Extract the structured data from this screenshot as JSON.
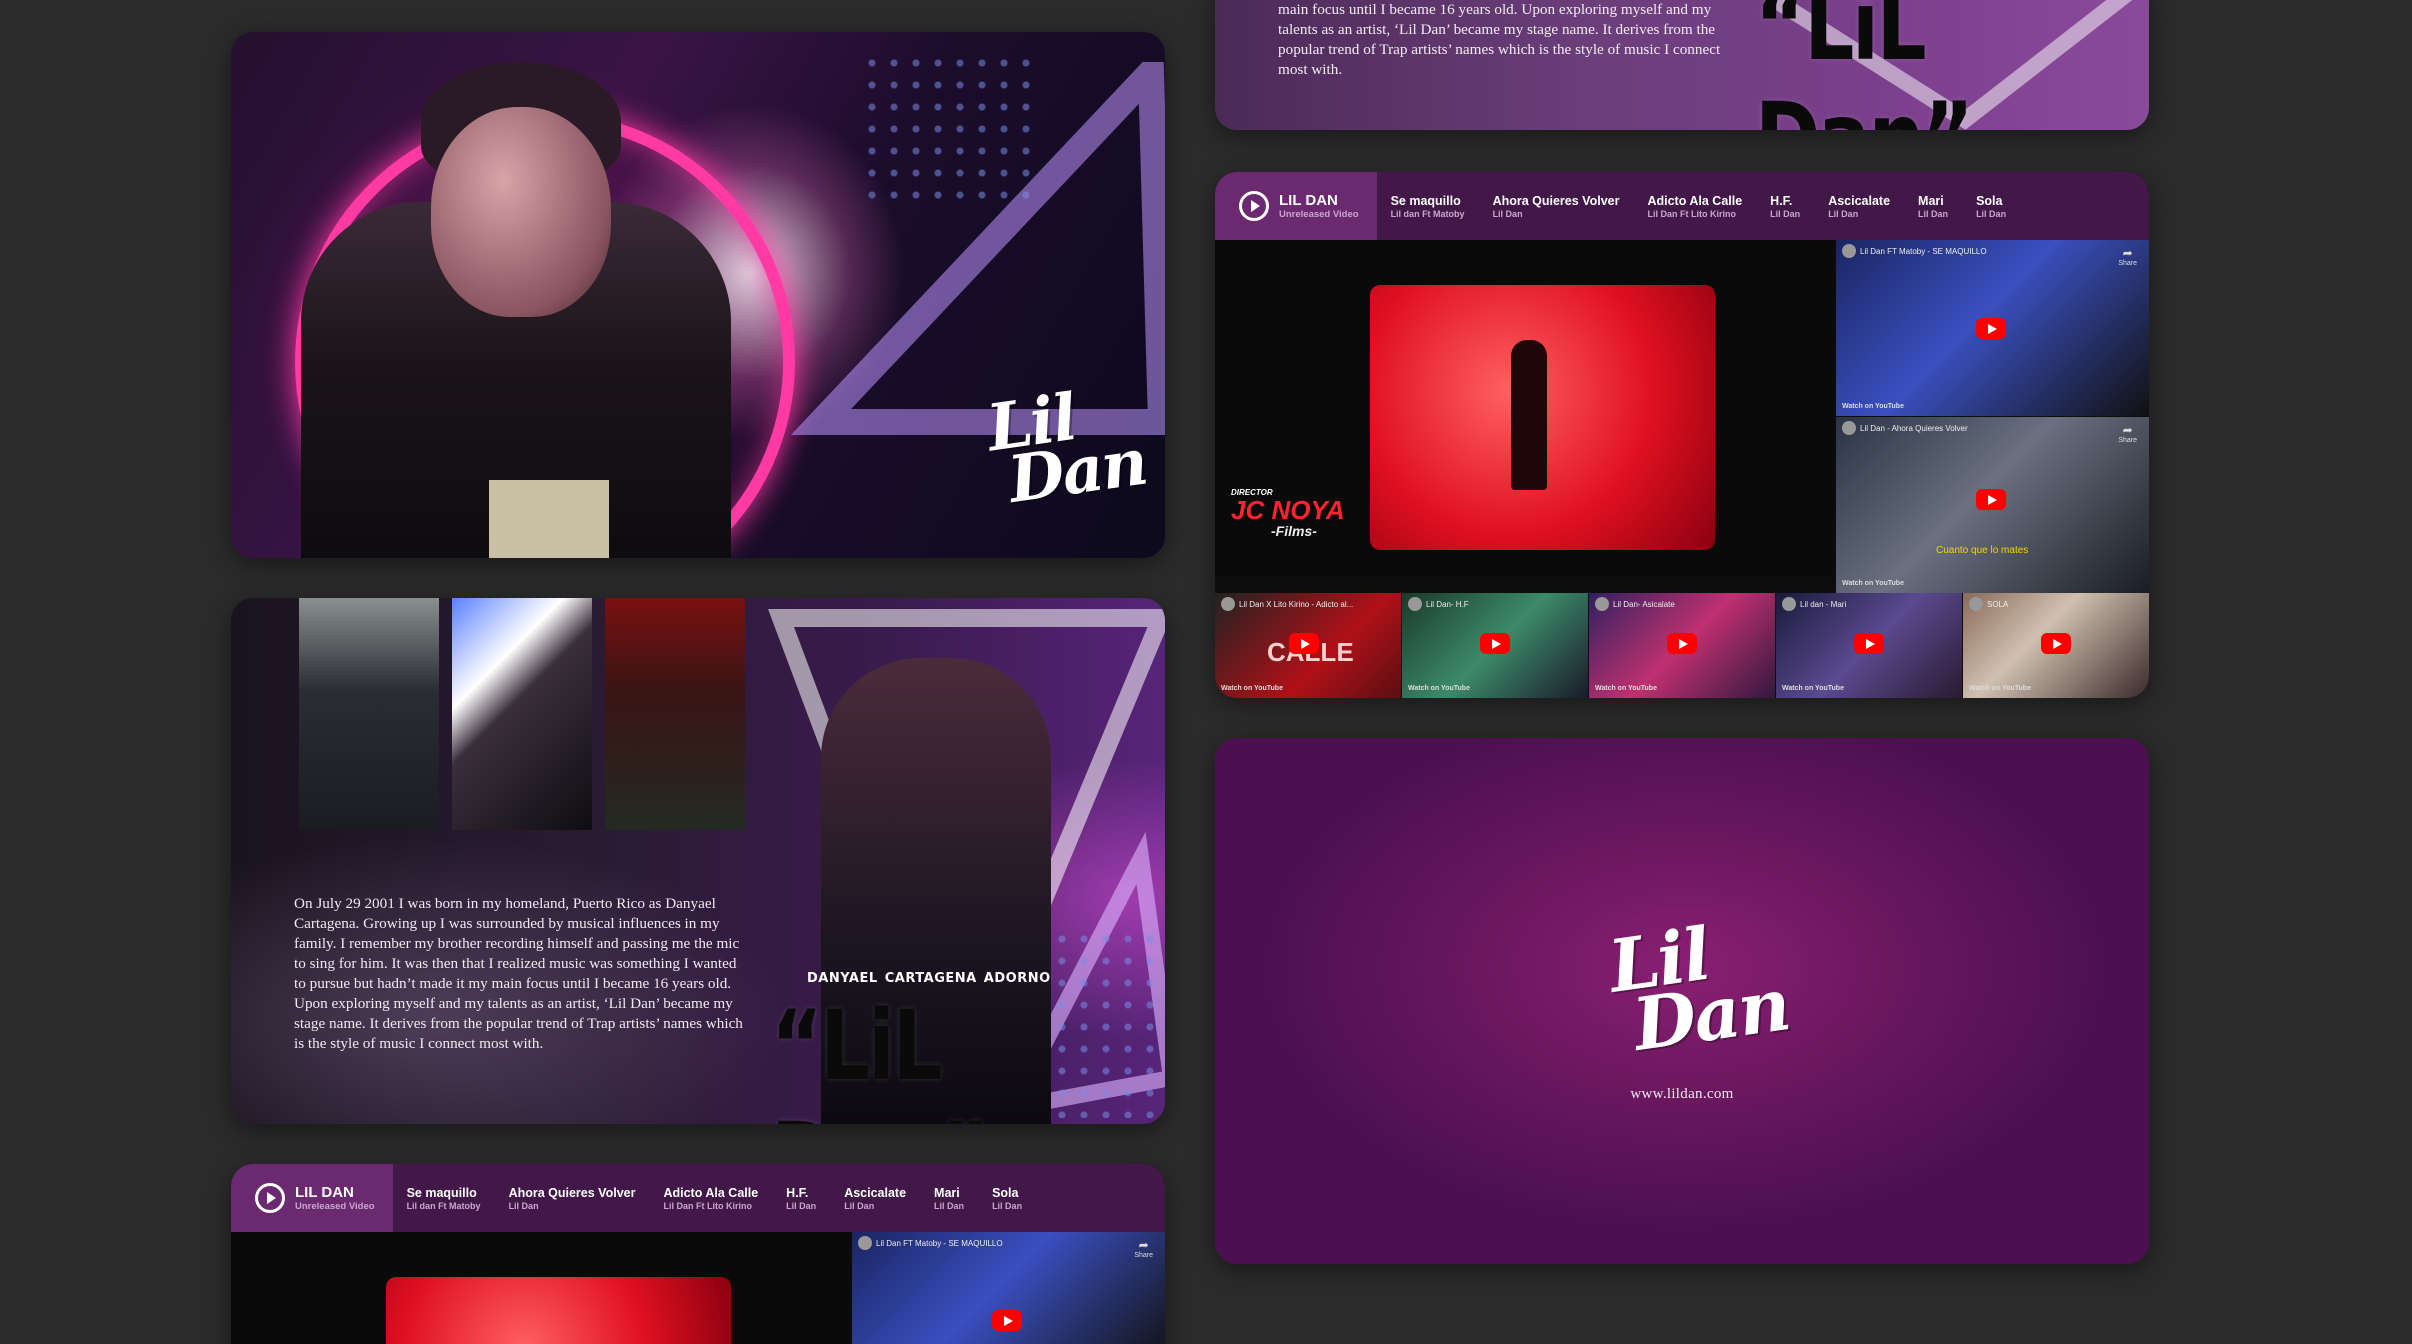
{
  "brand": {
    "logo_text_line1": "Lil",
    "logo_text_line2": "Dan",
    "website": "www.lildan.com"
  },
  "bio": {
    "fullname": "Danyael Cartagena Adorno",
    "stage_name": "“LiL Dan”",
    "paragraph": "On July 29 2001 I was born in my homeland, Puerto Rico as Danyael Cartagena. Growing up I was surrounded by musical influences in my family. I remember my brother recording himself and passing me the mic to sing for him. It was then that I realized music was something I wanted to pursue but hadn’t made it my main focus until I became 16 years old. Upon exploring myself and my talents as an artist, ‘Lil Dan’ became my stage name. It derives from the popular trend of Trap artists’ names which is the style of music I connect most with.",
    "paragraph_tail": "main focus until I became 16 years old. Upon exploring myself and my talents as an artist, ‘Lil Dan’ became my stage name. It derives from the popular trend of Trap artists’ names which is the style of music I connect most with."
  },
  "video": {
    "main_tab": {
      "title": "LIL DAN",
      "subtitle": "Unreleased Video"
    },
    "tabs": [
      {
        "title": "Se maquillo",
        "subtitle": "Lil dan Ft Matoby"
      },
      {
        "title": "Ahora Quieres Volver",
        "subtitle": "Lil Dan"
      },
      {
        "title": "Adicto Ala Calle",
        "subtitle": "Lil Dan Ft Lito Kirino"
      },
      {
        "title": "H.F.",
        "subtitle": "Lil Dan"
      },
      {
        "title": "Ascicalate",
        "subtitle": "Lil Dan"
      },
      {
        "title": "Mari",
        "subtitle": "Lil Dan"
      },
      {
        "title": "Sola",
        "subtitle": "Lil Dan"
      }
    ],
    "main_player_overlay": "JC NOYA",
    "main_player_overlay_small": "DIRECTOR",
    "main_player_overlay_sub": "-Films-",
    "side_videos": [
      {
        "title": "Lil Dan FT Matoby - SE MAQUILLO",
        "watch": "Watch on YouTube",
        "share": "Share"
      },
      {
        "title": "Lil Dan - Ahora Quieres Volver",
        "watch": "Watch on YouTube",
        "share": "Share",
        "caption": "Cuanto que lo mates"
      }
    ],
    "bottom_videos": [
      {
        "title": "Lil Dan X Lito Kirino - Adicto al...",
        "watch": "Watch on YouTube",
        "overlay": "CALLE"
      },
      {
        "title": "Lil Dan- H.F",
        "watch": "Watch on YouTube"
      },
      {
        "title": "Lil Dan- Asicalate",
        "watch": "Watch on YouTube"
      },
      {
        "title": "Lil dan - Mari",
        "watch": "Watch on YouTube"
      },
      {
        "title": "SOLA",
        "watch": "Watch on YouTube"
      }
    ]
  },
  "colors": {
    "background": "#2b2b2b",
    "tab_bar": "#421848",
    "tab_active": "#6b2a6f",
    "neon_pink": "#ff3aa5",
    "youtube_red": "#ff0000"
  }
}
